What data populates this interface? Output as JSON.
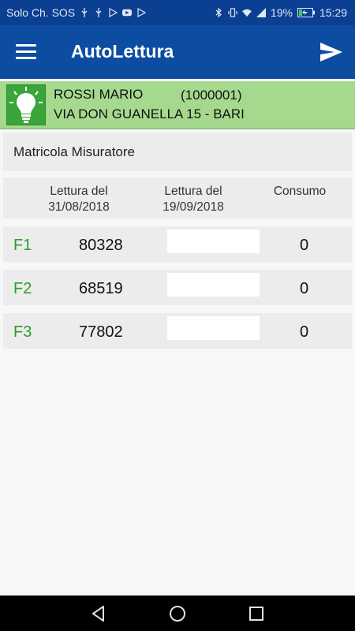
{
  "status_bar": {
    "carrier": "Solo Ch. SOS",
    "battery": "19%",
    "time": "15:29",
    "icons": [
      "usb-icon",
      "usb-icon",
      "play-store-icon",
      "youtube-icon",
      "play-store-icon",
      "bluetooth-icon",
      "vibrate-icon",
      "wifi-icon",
      "signal-icon",
      "battery-charging-icon"
    ]
  },
  "app_bar": {
    "title": "AutoLettura",
    "menu_icon": "hamburger-menu-icon",
    "send_icon": "send-icon"
  },
  "customer": {
    "icon": "lightbulb-icon",
    "name": "ROSSI MARIO",
    "code": "(1000001)",
    "address": "VIA DON GUANELLA 15 - BARI"
  },
  "matricola": {
    "label": "Matricola Misuratore"
  },
  "readings_header": {
    "col1_line1": "Lettura del",
    "col1_line2": "31/08/2018",
    "col2_line1": "Lettura del",
    "col2_line2": "19/09/2018",
    "col3": "Consumo"
  },
  "readings": [
    {
      "band": "F1",
      "previous": "80328",
      "new_value": "",
      "consumption": "0"
    },
    {
      "band": "F2",
      "previous": "68519",
      "new_value": "",
      "consumption": "0"
    },
    {
      "band": "F3",
      "previous": "77802",
      "new_value": "",
      "consumption": "0"
    }
  ],
  "nav_bar": {
    "back_icon": "back-triangle-icon",
    "home_icon": "home-circle-icon",
    "recents_icon": "recents-square-icon"
  },
  "colors": {
    "status_bar": "#0b3f91",
    "app_bar": "#0d4da1",
    "customer_band": "#a5d98e",
    "bulb_bg": "#3aa53a",
    "band_label": "#2e9b2e"
  }
}
